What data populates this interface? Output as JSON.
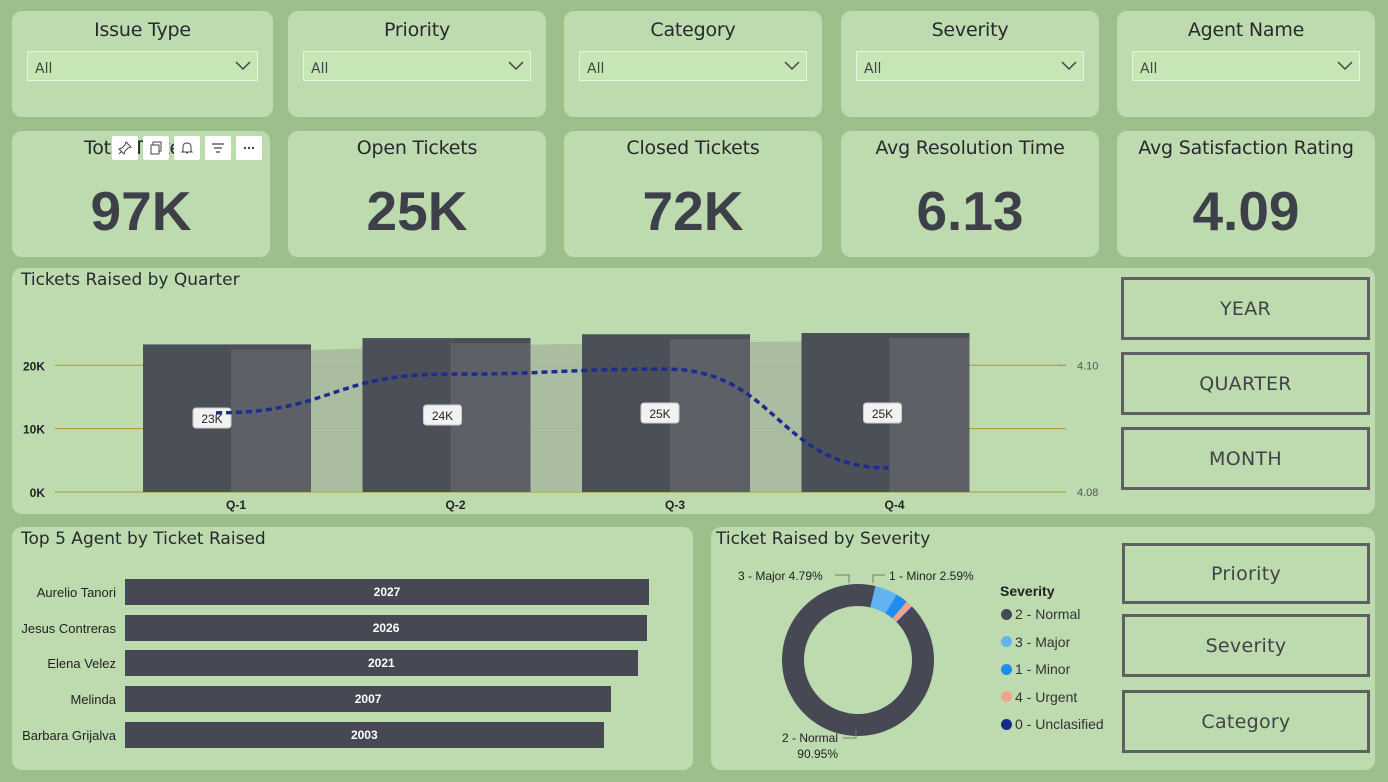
{
  "filters": [
    {
      "title": "Issue Type",
      "value": "All"
    },
    {
      "title": "Priority",
      "value": "All"
    },
    {
      "title": "Category",
      "value": "All"
    },
    {
      "title": "Severity",
      "value": "All"
    },
    {
      "title": "Agent Name",
      "value": "All"
    }
  ],
  "kpis": [
    {
      "title": "Total Tickets",
      "value": "97K"
    },
    {
      "title": "Open Tickets",
      "value": "25K"
    },
    {
      "title": "Closed Tickets",
      "value": "72K"
    },
    {
      "title": "Avg Resolution Time",
      "value": "6.13"
    },
    {
      "title": "Avg Satisfaction Rating",
      "value": "4.09"
    }
  ],
  "toolbar": {
    "icons": [
      "pin-icon",
      "copy-icon",
      "bell-icon",
      "filter-icon",
      "more-options-icon"
    ]
  },
  "time_nav": {
    "year": "YEAR",
    "quarter": "QUARTER",
    "month": "MONTH"
  },
  "breakdown_nav": {
    "priority": "Priority",
    "severity": "Severity",
    "category": "Category"
  },
  "colors": {
    "background": "#9dbf8b",
    "card": "#bedbb0",
    "bar_dark": "#464954",
    "line": "#1f2c8f",
    "gridline": "#a59a2a"
  },
  "chart_data": [
    {
      "type": "bar",
      "title": "Tickets Raised by Quarter",
      "categories": [
        "Q-1",
        "Q-2",
        "Q-3",
        "Q-4"
      ],
      "series": [
        {
          "values": [
            23300,
            24300,
            24900,
            25100
          ],
          "labels": [
            "23K",
            "24K",
            "25K",
            "25K"
          ]
        },
        {
          "type": "line",
          "axis": "secondary",
          "values": [
            4.0925,
            4.0986,
            4.0994,
            4.0838
          ]
        }
      ],
      "ylim": [
        0,
        25100
      ],
      "yticks": [
        "0K",
        "10K",
        "20K"
      ],
      "ytick_values": [
        0,
        10000,
        20000
      ],
      "y2lim": [
        4.08,
        4.1
      ],
      "y2ticks": [
        "4.08",
        "4.10"
      ],
      "grid": true
    },
    {
      "type": "bar",
      "orientation": "horizontal",
      "title": "Top 5 Agent by Ticket Raised",
      "categories": [
        "Aurelio Tanori",
        "Jesus Contreras",
        "Elena Velez",
        "Melinda",
        "Barbara Grijalva"
      ],
      "values": [
        2027,
        2026,
        2021,
        2007,
        2003
      ]
    },
    {
      "type": "pie",
      "title": "Ticket Raised by Severity",
      "legend_title": "Severity",
      "legend_position": "right",
      "slices": [
        {
          "label": "2 - Normal",
          "value": 90.95,
          "color": "#464954",
          "annotation": "2 - Normal",
          "annotation2": "90.95%"
        },
        {
          "label": "3 - Major",
          "value": 4.79,
          "color": "#62b4f0",
          "annotation": "3 - Major 4.79%"
        },
        {
          "label": "1 - Minor",
          "value": 2.59,
          "color": "#1f8cf0",
          "annotation": "1 - Minor 2.59%"
        },
        {
          "label": "4 - Urgent",
          "value": 1.5,
          "color": "#f0a58a"
        },
        {
          "label": "0 - Unclasified",
          "value": 0.17,
          "color": "#152a8c"
        }
      ]
    }
  ]
}
